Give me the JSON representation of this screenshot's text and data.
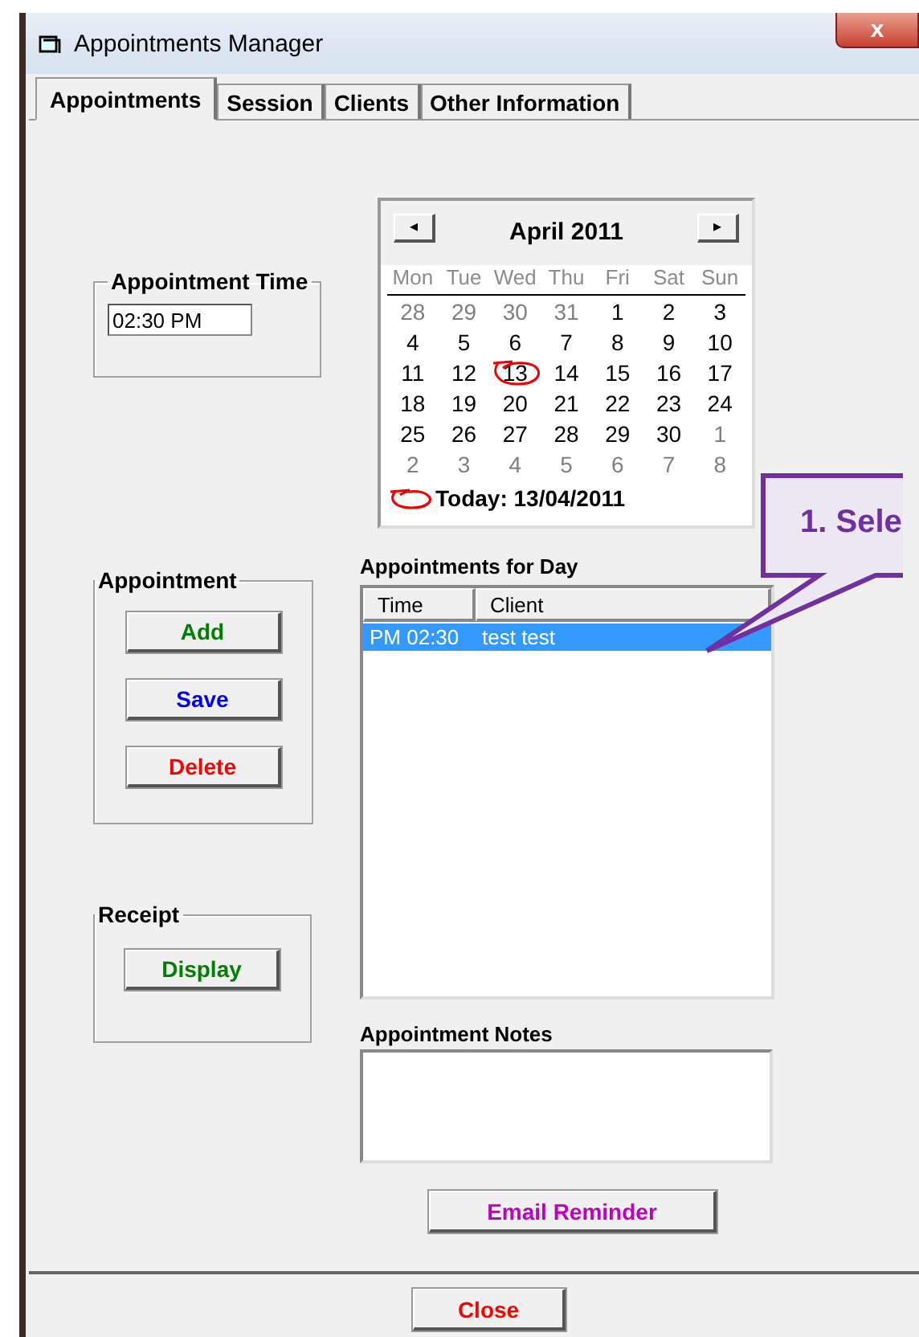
{
  "window": {
    "title": "Appointments Manager",
    "close_label": "x"
  },
  "tabs": [
    {
      "label": "Appointments",
      "selected": true
    },
    {
      "label": "Session",
      "selected": false
    },
    {
      "label": "Clients",
      "selected": false
    },
    {
      "label": "Other Information",
      "selected": false
    }
  ],
  "appointment_time": {
    "title": "Appointment Time",
    "value": "02:30 PM"
  },
  "appointment_group": {
    "title": "Appointment",
    "buttons": [
      {
        "label": "Add",
        "color": "#008000"
      },
      {
        "label": "Save",
        "color": "#0000ff"
      },
      {
        "label": "Delete",
        "color": "#ff0000"
      }
    ]
  },
  "receipt_group": {
    "title": "Receipt",
    "buttons": [
      {
        "label": "Display",
        "color": "#008000"
      }
    ]
  },
  "calendar": {
    "prev": "◂",
    "next": "▸",
    "month": "April 2011",
    "weekdays": [
      "Mon",
      "Tue",
      "Wed",
      "Thu",
      "Fri",
      "Sat",
      "Sun"
    ],
    "weeks": [
      [
        {
          "d": "28",
          "dim": true,
          "circled": false
        },
        {
          "d": "29",
          "dim": true,
          "circled": false
        },
        {
          "d": "30",
          "dim": true,
          "circled": false
        },
        {
          "d": "31",
          "dim": true,
          "circled": false
        },
        {
          "d": "1",
          "dim": false,
          "circled": false
        },
        {
          "d": "2",
          "dim": false,
          "circled": false
        },
        {
          "d": "3",
          "dim": false,
          "circled": false
        }
      ],
      [
        {
          "d": "4",
          "dim": false,
          "circled": false
        },
        {
          "d": "5",
          "dim": false,
          "circled": false
        },
        {
          "d": "6",
          "dim": false,
          "circled": false
        },
        {
          "d": "7",
          "dim": false,
          "circled": false
        },
        {
          "d": "8",
          "dim": false,
          "circled": false
        },
        {
          "d": "9",
          "dim": false,
          "circled": false
        },
        {
          "d": "10",
          "dim": false,
          "circled": false
        }
      ],
      [
        {
          "d": "11",
          "dim": false,
          "circled": false
        },
        {
          "d": "12",
          "dim": false,
          "circled": false
        },
        {
          "d": "13",
          "dim": false,
          "circled": true
        },
        {
          "d": "14",
          "dim": false,
          "circled": false
        },
        {
          "d": "15",
          "dim": false,
          "circled": false
        },
        {
          "d": "16",
          "dim": false,
          "circled": false
        },
        {
          "d": "17",
          "dim": false,
          "circled": false
        }
      ],
      [
        {
          "d": "18",
          "dim": false,
          "circled": false
        },
        {
          "d": "19",
          "dim": false,
          "circled": false
        },
        {
          "d": "20",
          "dim": false,
          "circled": false
        },
        {
          "d": "21",
          "dim": false,
          "circled": false
        },
        {
          "d": "22",
          "dim": false,
          "circled": false
        },
        {
          "d": "23",
          "dim": false,
          "circled": false
        },
        {
          "d": "24",
          "dim": false,
          "circled": false
        }
      ],
      [
        {
          "d": "25",
          "dim": false,
          "circled": false
        },
        {
          "d": "26",
          "dim": false,
          "circled": false
        },
        {
          "d": "27",
          "dim": false,
          "circled": false
        },
        {
          "d": "28",
          "dim": false,
          "circled": false
        },
        {
          "d": "29",
          "dim": false,
          "circled": false
        },
        {
          "d": "30",
          "dim": false,
          "circled": false
        },
        {
          "d": "1",
          "dim": true,
          "circled": false
        }
      ],
      [
        {
          "d": "2",
          "dim": true,
          "circled": false
        },
        {
          "d": "3",
          "dim": true,
          "circled": false
        },
        {
          "d": "4",
          "dim": true,
          "circled": false
        },
        {
          "d": "5",
          "dim": true,
          "circled": false
        },
        {
          "d": "6",
          "dim": true,
          "circled": false
        },
        {
          "d": "7",
          "dim": true,
          "circled": false
        },
        {
          "d": "8",
          "dim": true,
          "circled": false
        }
      ]
    ],
    "today": "Today: 13/04/2011"
  },
  "appointments_for_day": {
    "title": "Appointments for Day",
    "columns": [
      "Time",
      "Client"
    ],
    "rows": [
      {
        "time": "PM 02:30",
        "client": "test test",
        "selected": true
      }
    ]
  },
  "appointment_notes": {
    "title": "Appointment Notes"
  },
  "email_button": {
    "label": "Email Reminder",
    "color": "#c000c0"
  },
  "close_button": {
    "label": "Close",
    "color": "#ff0000"
  },
  "callout": {
    "text": "1. Sele"
  }
}
